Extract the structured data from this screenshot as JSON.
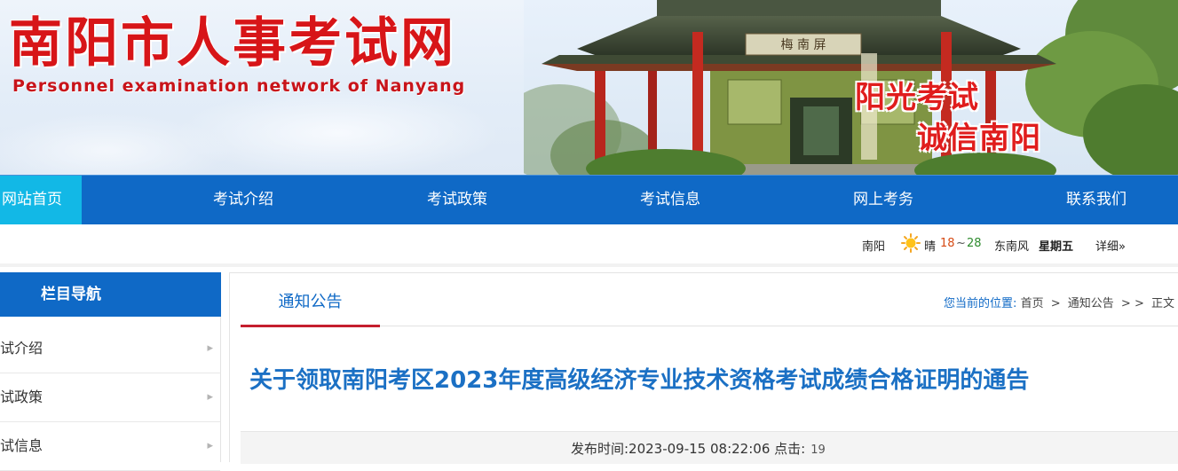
{
  "header": {
    "site_title": "南阳市人事考试网",
    "site_subtitle": "Personnel examination network of Nanyang",
    "slogan_line1": "阳光考试",
    "slogan_line2": "诚信南阳",
    "pavilion_plaque": "梅 南 屏",
    "colors": {
      "title_red": "#d71518",
      "nav_blue": "#0f69c6",
      "nav_home_cyan": "#12b8e6"
    }
  },
  "nav": {
    "home": "网站首页",
    "items": [
      "考试介绍",
      "考试政策",
      "考试信息",
      "网上考务",
      "联系我们"
    ]
  },
  "weather": {
    "city": "南阳",
    "icon": "sun-icon",
    "condition": "晴",
    "low": "18",
    "tilde": "~",
    "high": "28",
    "wind": "东南风",
    "weekday": "星期五",
    "detail_link": "详细»"
  },
  "sidebar": {
    "heading": "栏目导航",
    "items": [
      {
        "label": "试介绍",
        "arrow": "chevron-right-icon"
      },
      {
        "label": "试政策",
        "arrow": "chevron-right-icon"
      },
      {
        "label": "试信息",
        "arrow": "chevron-right-icon"
      }
    ]
  },
  "main": {
    "tab": "通知公告",
    "breadcrumb": {
      "label": "您当前的位置:",
      "home": "首页",
      "sep": ">",
      "section": "通知公告",
      "extra": "> >",
      "current": "正文"
    },
    "article_title": "关于领取南阳考区2023年度高级经济专业技术资格考试成绩合格证明的通告",
    "publish": "发布时间:2023-09-15 08:22:06 点击:",
    "clicks": "19"
  }
}
